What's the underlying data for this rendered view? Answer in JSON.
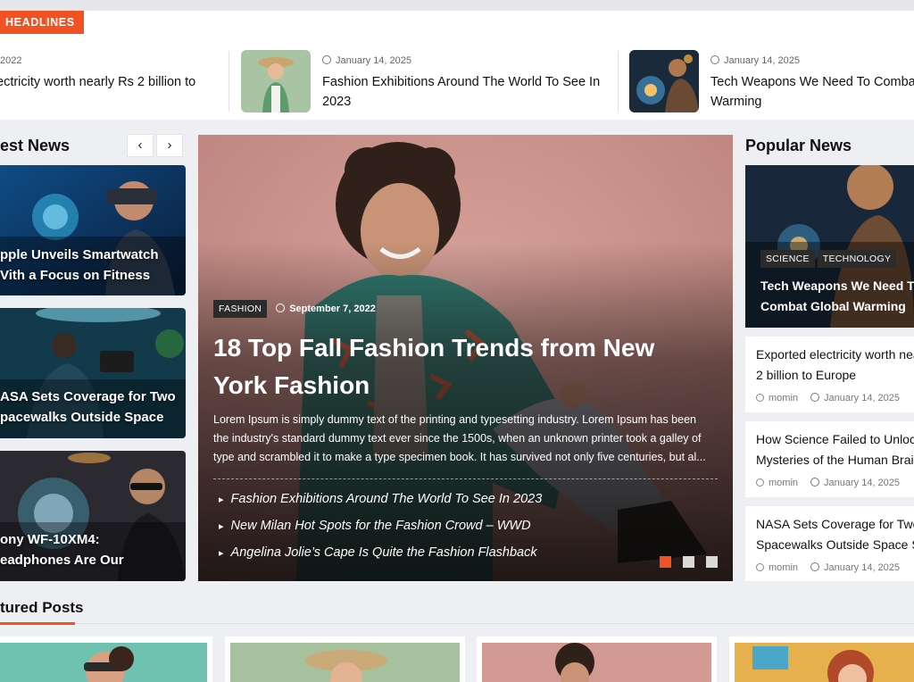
{
  "ticker": {
    "badge": "HEADLINES",
    "items": [
      {
        "date": "2022",
        "title": "ectricity worth nearly Rs 2 billion to",
        "title2": ""
      },
      {
        "date": "January 14, 2025",
        "title": "Fashion Exhibitions Around The World To See In",
        "title2": "2023"
      },
      {
        "date": "January 14, 2025",
        "title": "Tech Weapons We Need To Combat G",
        "title2": "Warming"
      }
    ]
  },
  "latest": {
    "heading": "est News",
    "prev_icon": "‹",
    "next_icon": "›",
    "cards": [
      {
        "line1": "pple Unveils Smartwatch",
        "line2": "Vith a Focus on Fitness"
      },
      {
        "line1": "ASA Sets Coverage for Two",
        "line2": "pacewalks Outside Space"
      },
      {
        "line1": "ony WF-10XM4:",
        "line2": "eadphones Are Our"
      }
    ]
  },
  "hero": {
    "category": "FASHION",
    "date": "September 7, 2022",
    "title": "18 Top Fall Fashion Trends from New York Fashion",
    "description": "Lorem Ipsum is simply dummy text of the printing and typesetting industry. Lorem Ipsum has been the industry's standard dummy text ever since the 1500s, when an unknown printer took a galley of type and scrambled it to make a type specimen book. It has survived not only five centuries, but al...",
    "links": [
      "Fashion Exhibitions Around The World To See In 2023",
      "New Milan Hot Spots for the Fashion Crowd – WWD",
      "Angelina Jolie’s Cape Is Quite the Fashion Flashback"
    ],
    "active_slide": 1,
    "slide_count": 3,
    "colors": {
      "active_dot": "#f05223",
      "inactive_dot": "#d9d9d9"
    }
  },
  "popular": {
    "heading": "Popular News",
    "featured": {
      "categories": [
        "SCIENCE",
        "TECHNOLOGY"
      ],
      "line1": "Tech Weapons We Need To",
      "line2": "Combat Global Warming"
    },
    "items": [
      {
        "line1": "Exported electricity worth nea",
        "line2": "2 billion to Europe",
        "author": "momin",
        "date": "January 14, 2025"
      },
      {
        "line1": "How Science Failed to Unlock",
        "line2": "Mysteries of the Human Brain",
        "author": "momin",
        "date": "January 14, 2025"
      },
      {
        "line1": "NASA Sets Coverage for Two",
        "line2": "Spacewalks Outside Space St",
        "author": "momin",
        "date": "January 14, 2025"
      }
    ]
  },
  "featured": {
    "heading": "tured Posts"
  },
  "colors": {
    "accent": "#f05223",
    "background": "#eeeff3"
  }
}
